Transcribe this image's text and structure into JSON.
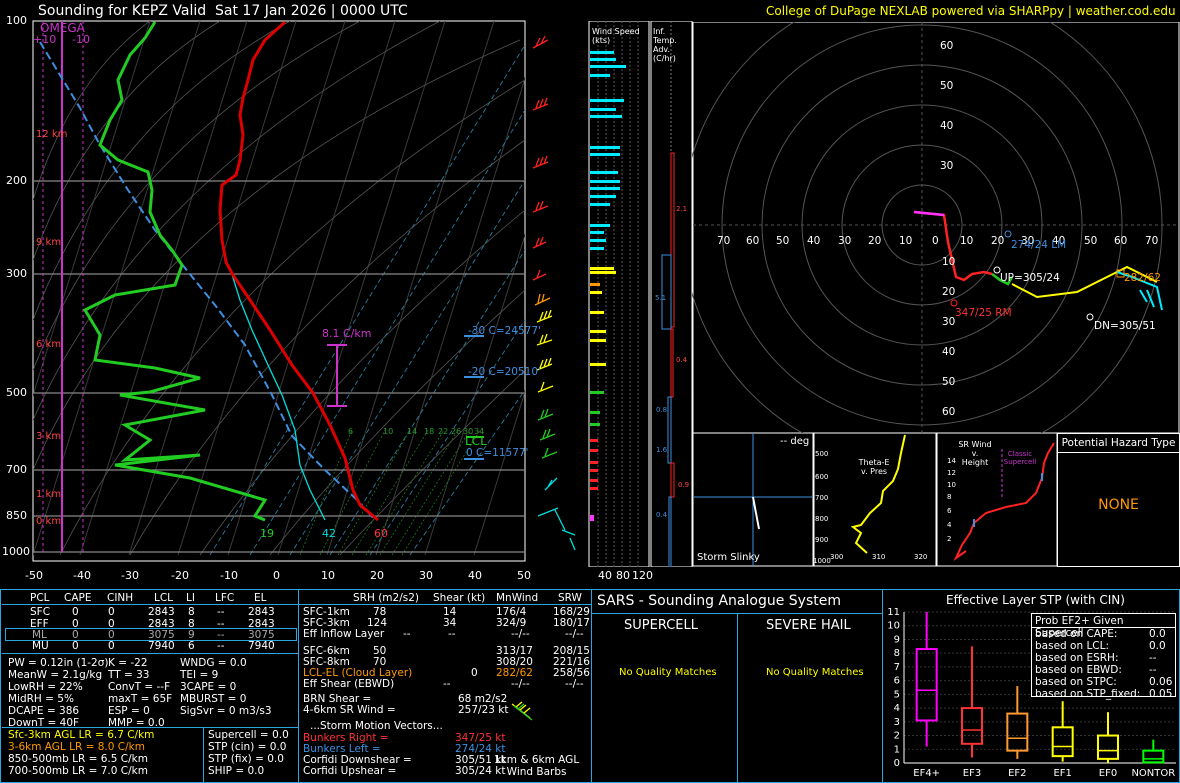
{
  "header": {
    "title": "Sounding for KEPZ Valid  Sat 17 Jan 2026 | 0000 UTC",
    "credit": "College of DuPage NEXLAB powered via SHARPpy | weather.cod.edu"
  },
  "colors": {
    "temp": "#ff0000",
    "dew": "#00cc00",
    "wetbulb": "#00ffff",
    "parcel": "#4aa0ff",
    "omega": "#cc33cc",
    "yellow": "#ffff00",
    "orange": "#ff9900",
    "cyan": "#00ffff",
    "magenta": "#ff33ff",
    "border": "#2aa7e0"
  },
  "skewt": {
    "omega_label": "OMEGA",
    "omega_ticks": [
      "+10",
      "-10"
    ],
    "pressure_ticks": [
      "100",
      "200",
      "300",
      "400",
      "500",
      "700",
      "850",
      "1000"
    ],
    "temp_ticks": [
      "-50",
      "-40",
      "-30",
      "-20",
      "-10",
      "0",
      "10",
      "20",
      "30",
      "40",
      "50"
    ],
    "height_labels": [
      "12 km",
      "9 km",
      "6 km",
      "3 km",
      "1 km",
      "0 km"
    ],
    "lapse_label": "8.1 C/km",
    "isotherm_labels": [
      "-30 C=24577'",
      "-20 C=20510'",
      "0 C=11577'"
    ],
    "lcl_label": "LCL",
    "mixing_ratio_labels": [
      "6",
      "10",
      "14",
      "18",
      "22",
      "26",
      "30",
      "34"
    ],
    "surface_values": [
      "19",
      "42",
      "60"
    ]
  },
  "wind_speed": {
    "title": "Wind Speed (kts)",
    "ticks": [
      "40",
      "80",
      "120"
    ]
  },
  "temp_adv": {
    "title": "Inf. Temp. Adv. (C/hr)",
    "labels": [
      "2.1",
      "5.1",
      "0.4",
      "0.8",
      "1.6",
      "0.9",
      "0.4"
    ]
  },
  "hodograph": {
    "rings_up": [
      "60",
      "50",
      "40",
      "30",
      "20",
      "10"
    ],
    "rings_down": [
      "10",
      "20",
      "30",
      "40",
      "50",
      "60"
    ],
    "x_left": [
      "70",
      "60",
      "50",
      "40",
      "30",
      "20",
      "10"
    ],
    "x_right": [
      "0",
      "10",
      "20",
      "30",
      "40",
      "50",
      "60",
      "70"
    ],
    "labels": {
      "lm": "274/24 LM",
      "up": "UP=305/24",
      "rm": "347/25 RM",
      "dn": "DN=305/51",
      "mean": "282/62"
    }
  },
  "storm_slinky": {
    "title": "-- deg",
    "label": "Storm Slinky"
  },
  "theta": {
    "label": "Theta-E v. Pres",
    "y_ticks": [
      "500",
      "600",
      "700",
      "800",
      "900",
      "1000"
    ],
    "x_ticks": [
      "300",
      "310",
      "320"
    ]
  },
  "srwind": {
    "label": "SR Wind v. Height",
    "classic": "Classic Supercell",
    "y_ticks": [
      "14",
      "12",
      "10",
      "8",
      "6",
      "4",
      "2"
    ]
  },
  "hazard": {
    "title": "Potential Hazard Type",
    "value": "NONE"
  },
  "parcel_table": {
    "headers": [
      "PCL",
      "CAPE",
      "CINH",
      "LCL",
      "LI",
      "LFC",
      "EL"
    ],
    "rows": [
      [
        "SFC",
        "0",
        "0",
        "2843",
        "8",
        "--",
        "2843"
      ],
      [
        "EFF",
        "0",
        "0",
        "2843",
        "8",
        "--",
        "2843"
      ],
      [
        "ML",
        "0",
        "0",
        "3075",
        "9",
        "--",
        "3075"
      ],
      [
        "MU",
        "0",
        "0",
        "7940",
        "6",
        "--",
        "7940"
      ]
    ]
  },
  "indices": {
    "col1": [
      "PW = 0.12in (1-2σ)",
      "MeanW = 2.1g/kg",
      "LowRH = 22%",
      "MidRH = 5%",
      "DCAPE = 386",
      "DownT = 40F"
    ],
    "col2": [
      "K = -22",
      "TT = 33",
      "ConvT = --F",
      "maxT = 65F",
      "ESP = 0",
      "MMP = 0.0"
    ],
    "col3": [
      "WNDG = 0.0",
      "TEI = 9",
      "3CAPE = 0",
      "MBURST = 0",
      "",
      "SigSvr = 0 m3/s3"
    ]
  },
  "lapse_rates": [
    "Sfc-3km AGL LR = 6.7 C/km",
    "3-6km AGL LR = 8.0 C/km",
    "850-500mb LR = 6.5 C/km",
    "700-500mb LR = 7.0 C/km"
  ],
  "composites": [
    "Supercell = 0.0",
    "STP (cin) = 0.0",
    "STP (fix) = 0.0",
    "SHIP = 0.0"
  ],
  "kin_table": {
    "headers": [
      "SRH (m2/s2)",
      "Shear (kt)",
      "MnWind",
      "SRW"
    ],
    "rows": [
      [
        "SFC-1km",
        "78",
        "14",
        "176/4",
        "168/29"
      ],
      [
        "SFC-3km",
        "124",
        "34",
        "324/9",
        "180/17"
      ],
      [
        "Eff Inflow Layer",
        "--",
        "--",
        "--/--",
        "--/--"
      ],
      [
        "SFC-6km",
        "50",
        "",
        "313/17",
        "208/15"
      ],
      [
        "SFC-8km",
        "70",
        "",
        "308/20",
        "221/16"
      ],
      [
        "LCL-EL (Cloud Layer)",
        "0",
        "",
        "282/62",
        "258/56"
      ],
      [
        "Eff Shear (EBWD)",
        "--",
        "",
        "--/--",
        "--/--"
      ]
    ],
    "brn": "BRN Shear =",
    "brn_val": "68 m2/s2",
    "sr46": "4-6km SR Wind =",
    "sr46_val": "257/23 kt",
    "motion_title": "...Storm Motion Vectors...",
    "motion": [
      [
        "Bunkers Right =",
        "347/25 kt"
      ],
      [
        "Bunkers Left =",
        "274/24 kt"
      ],
      [
        "Corfidi Downshear =",
        "305/51 kt"
      ],
      [
        "Corfidi Upshear =",
        "305/24 kt"
      ]
    ],
    "barb_label": "1km & 6km AGL\nWind Barbs"
  },
  "sars": {
    "title": "SARS - Sounding Analogue System",
    "supercell": "SUPERCELL",
    "hail": "SEVERE HAIL",
    "no_match": "No Quality Matches"
  },
  "stp": {
    "title": "Effective Layer STP (with CIN)",
    "legend_title": "Prob EF2+ Given Supercell",
    "legend": [
      [
        "based on CAPE:",
        "0.0"
      ],
      [
        "based on LCL:",
        "0.0"
      ],
      [
        "based on ESRH:",
        "--"
      ],
      [
        "based on EBWD:",
        "--"
      ],
      [
        "based on STPC:",
        "0.06"
      ],
      [
        "based on STP_fixed:",
        "0.05"
      ]
    ]
  },
  "chart_data": {
    "type": "bar",
    "title": "Effective Layer STP (with CIN)",
    "categories": [
      "EF4+",
      "EF3",
      "EF2",
      "EF1",
      "EF0",
      "NONTOR"
    ],
    "ylim": [
      0,
      11
    ],
    "y_ticks": [
      "0",
      "1",
      "2",
      "3",
      "4",
      "5",
      "6",
      "7",
      "8",
      "9",
      "10",
      "11"
    ],
    "boxes": [
      {
        "min": 1.2,
        "q1": 3.1,
        "median": 5.3,
        "q3": 8.3,
        "max": 11.0
      },
      {
        "min": 0.4,
        "q1": 1.4,
        "median": 2.4,
        "q3": 4.0,
        "max": 8.5
      },
      {
        "min": 0.3,
        "q1": 0.9,
        "median": 1.8,
        "q3": 3.6,
        "max": 5.6
      },
      {
        "min": 0.1,
        "q1": 0.5,
        "median": 1.2,
        "q3": 2.6,
        "max": 4.5
      },
      {
        "min": 0.0,
        "q1": 0.3,
        "median": 0.9,
        "q3": 2.0,
        "max": 3.7
      },
      {
        "min": 0.0,
        "q1": 0.05,
        "median": 0.3,
        "q3": 0.9,
        "max": 1.7
      }
    ],
    "box_colors": [
      "#ff00ff",
      "#ff3333",
      "#ff9933",
      "#ffff00",
      "#ffff00",
      "#00ff00"
    ],
    "grid": true
  }
}
